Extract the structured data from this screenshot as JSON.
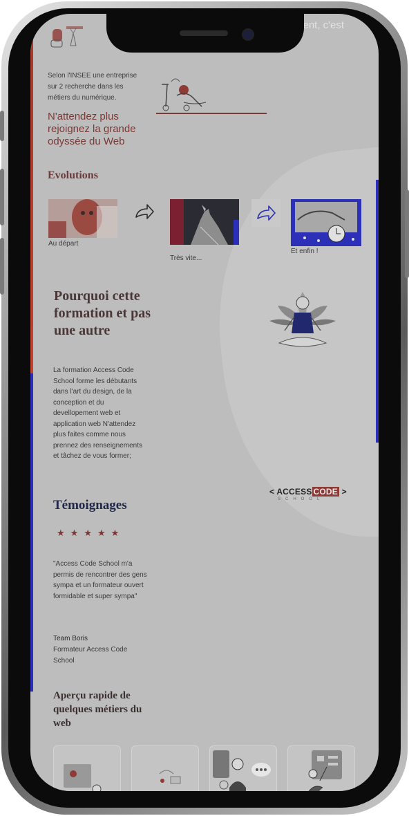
{
  "status_overflow_text": "ment, c'est",
  "hero": {
    "insee_text": "Selon l'INSEE une entreprise sur 2 recherche dans les métiers du numérique.",
    "cta_text": "N'attendez plus rejoignez la grande odyssée du Web"
  },
  "evolutions": {
    "title": "Evolutions",
    "steps": [
      {
        "caption": "Au départ"
      },
      {
        "caption": "Très vite..."
      },
      {
        "caption": "Et enfin !"
      }
    ]
  },
  "why": {
    "title": "Pourquoi cette formation et pas une autre",
    "paragraph": "La formation Access Code School forme les débutants dans l'art du design, de la conception et du devellopement web et application web N'attendez plus faites comme nous prennez des renseignements et tâchez de vous former;"
  },
  "logo": {
    "left_bracket": "<",
    "access": "ACCESS",
    "code": "CODE",
    "right_bracket": ">",
    "school": "SCHOOL"
  },
  "testimonials": {
    "title": "Témoignages",
    "stars": [
      "★",
      "★",
      "★",
      "★",
      "★"
    ],
    "quote": "\"Access Code School m'a permis de rencontrer des gens sympa et un formateur ouvert formidable et super sympa\"",
    "author_name": "Team Boris",
    "author_role": "Formateur Access Code School"
  },
  "jobs": {
    "title": "Aperçu rapide de quelques métiers du web"
  },
  "colors": {
    "accent_red": "#8e3a36",
    "accent_blue": "#2c2fb8",
    "heading_navy": "#22284a"
  }
}
